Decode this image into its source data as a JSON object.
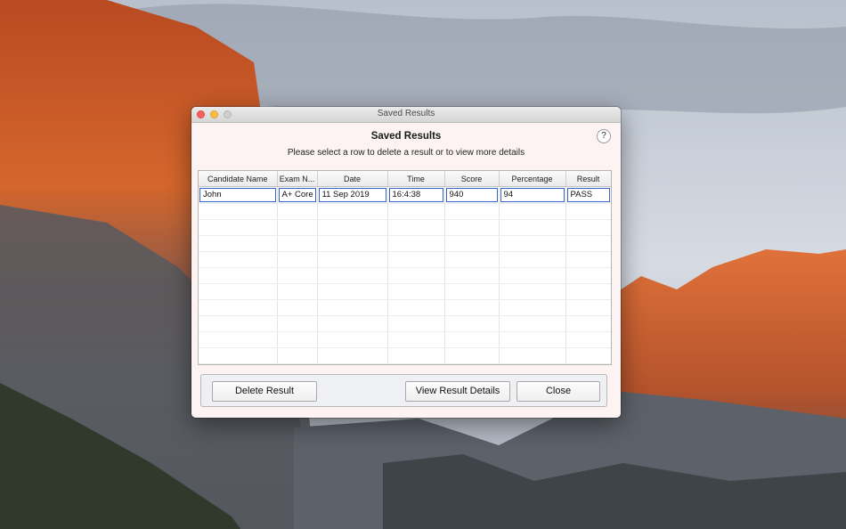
{
  "window": {
    "title": "Saved Results",
    "heading": "Saved Results",
    "subheading": "Please select a row to delete a result or to view more details",
    "help_label": "?"
  },
  "table": {
    "columns": [
      "Candidate Name",
      "Exam N...",
      "Date",
      "Time",
      "Score",
      "Percentage",
      "Result"
    ],
    "rows": [
      [
        "John",
        "A+ Core",
        "11 Sep 2019",
        "16:4:38",
        "940",
        "94",
        "PASS"
      ]
    ],
    "empty_rows": 10
  },
  "buttons": {
    "delete": "Delete Result",
    "view_details": "View Result Details",
    "close": "Close"
  },
  "colors": {
    "selection_border": "#3564c8",
    "close_light": "#fc605b",
    "minimize_light": "#fdbc40",
    "zoom_light": "#cfcfcf"
  }
}
